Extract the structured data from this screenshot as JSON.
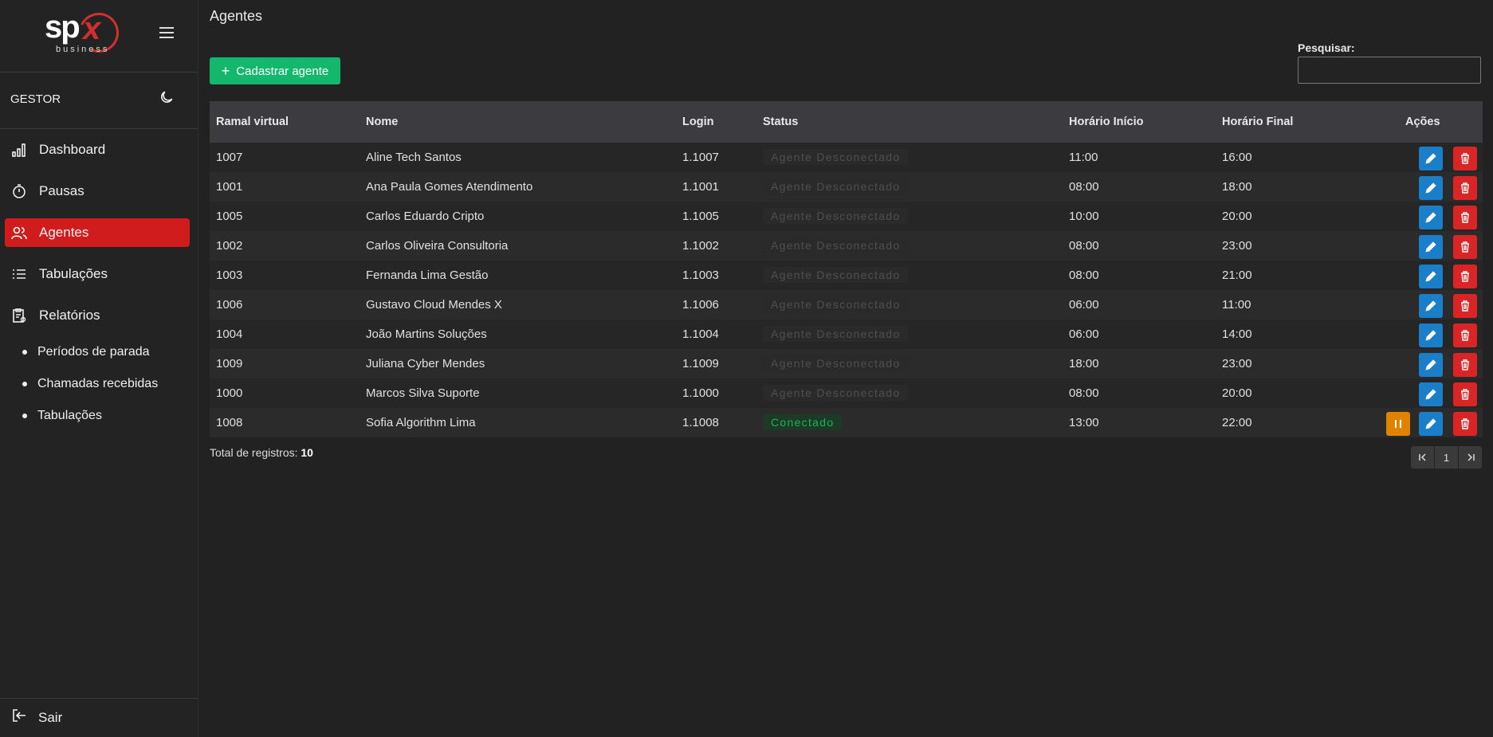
{
  "brand": {
    "logo_text": "spx",
    "logo_sub": "business"
  },
  "sidebar": {
    "role_label": "GESTOR",
    "items": [
      {
        "label": "Dashboard",
        "icon": "chart-icon"
      },
      {
        "label": "Pausas",
        "icon": "stopwatch-icon"
      },
      {
        "label": "Agentes",
        "icon": "users-icon",
        "active": true
      },
      {
        "label": "Tabulações",
        "icon": "list-icon"
      },
      {
        "label": "Relatórios",
        "icon": "report-icon"
      }
    ],
    "sub_items": [
      {
        "label": "Períodos de parada"
      },
      {
        "label": "Chamadas recebidas"
      },
      {
        "label": "Tabulações"
      }
    ],
    "logout_label": "Sair"
  },
  "page": {
    "title": "Agentes",
    "add_button": "Cadastrar agente",
    "search_label": "Pesquisar:",
    "search_value": ""
  },
  "table": {
    "headers": [
      "Ramal virtual",
      "Nome",
      "Login",
      "Status",
      "Horário Início",
      "Horário Final",
      "Ações"
    ],
    "rows": [
      {
        "ramal": "1007",
        "nome": "Aline Tech Santos",
        "login": "1.1007",
        "status": "Agente Desconectado",
        "inicio": "11:00",
        "fim": "16:00"
      },
      {
        "ramal": "1001",
        "nome": "Ana Paula Gomes Atendimento",
        "login": "1.1001",
        "status": "Agente Desconectado",
        "inicio": "08:00",
        "fim": "18:00"
      },
      {
        "ramal": "1005",
        "nome": "Carlos Eduardo Cripto",
        "login": "1.1005",
        "status": "Agente Desconectado",
        "inicio": "10:00",
        "fim": "20:00"
      },
      {
        "ramal": "1002",
        "nome": "Carlos Oliveira Consultoria",
        "login": "1.1002",
        "status": "Agente Desconectado",
        "inicio": "08:00",
        "fim": "23:00"
      },
      {
        "ramal": "1003",
        "nome": "Fernanda Lima Gestão",
        "login": "1.1003",
        "status": "Agente Desconectado",
        "inicio": "08:00",
        "fim": "21:00"
      },
      {
        "ramal": "1006",
        "nome": "Gustavo Cloud Mendes X",
        "login": "1.1006",
        "status": "Agente Desconectado",
        "inicio": "06:00",
        "fim": "11:00"
      },
      {
        "ramal": "1004",
        "nome": "João Martins Soluções",
        "login": "1.1004",
        "status": "Agente Desconectado",
        "inicio": "06:00",
        "fim": "14:00"
      },
      {
        "ramal": "1009",
        "nome": "Juliana Cyber Mendes",
        "login": "1.1009",
        "status": "Agente Desconectado",
        "inicio": "18:00",
        "fim": "23:00"
      },
      {
        "ramal": "1000",
        "nome": "Marcos Silva Suporte",
        "login": "1.1000",
        "status": "Agente Desconectado",
        "inicio": "08:00",
        "fim": "20:00"
      },
      {
        "ramal": "1008",
        "nome": "Sofia Algorithm Lima",
        "login": "1.1008",
        "status": "Conectado",
        "inicio": "13:00",
        "fim": "22:00",
        "connected": true
      }
    ]
  },
  "footer": {
    "total_label": "Total de registros:",
    "total_value": "10",
    "page": "1"
  },
  "colors": {
    "accent_red": "#d01c1c",
    "add_green": "#14b86d",
    "edit_blue": "#1a7ec8",
    "delete_red": "#d92525",
    "pause_orange": "#e28300"
  }
}
